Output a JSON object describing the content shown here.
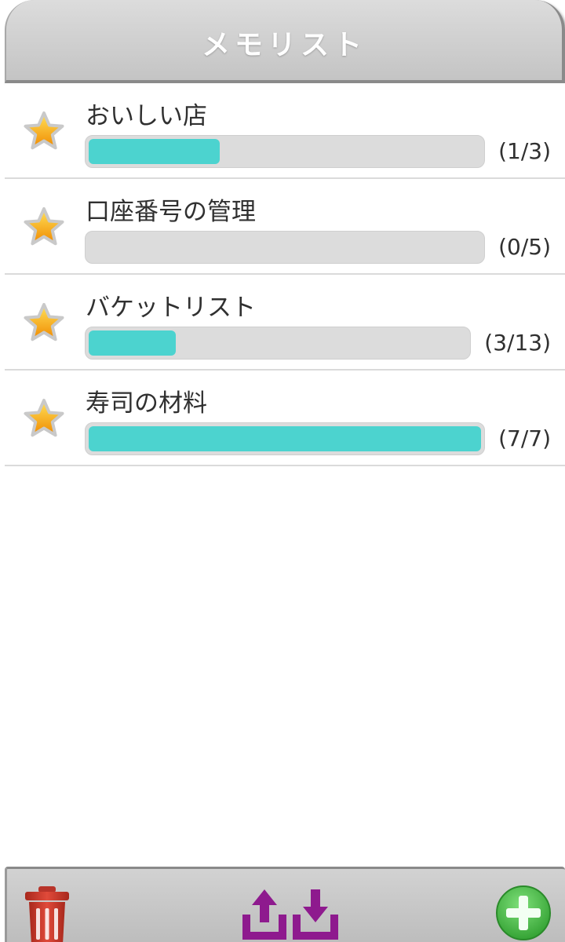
{
  "header": {
    "title": "メモリスト"
  },
  "memos": [
    {
      "title": "おいしい店",
      "count_label": "(1/3)",
      "done": 1,
      "total": 3
    },
    {
      "title": "口座番号の管理",
      "count_label": "(0/5)",
      "done": 0,
      "total": 5
    },
    {
      "title": "バケットリスト",
      "count_label": "(3/13)",
      "done": 3,
      "total": 13
    },
    {
      "title": "寿司の材料",
      "count_label": "(7/7)",
      "done": 7,
      "total": 7
    }
  ],
  "toolbar": {
    "buttons": [
      {
        "icon": "trash-icon",
        "color": "#c0392b"
      },
      {
        "icon": "share-upload-icon",
        "color": "#8e1a8e"
      },
      {
        "icon": "import-download-icon",
        "color": "#8e1a8e"
      },
      {
        "icon": "plus-circle-icon",
        "color": "#3fae3f"
      }
    ]
  },
  "colors": {
    "progress_fill": "#4cd3cf",
    "progress_track": "#dcdcdc"
  }
}
